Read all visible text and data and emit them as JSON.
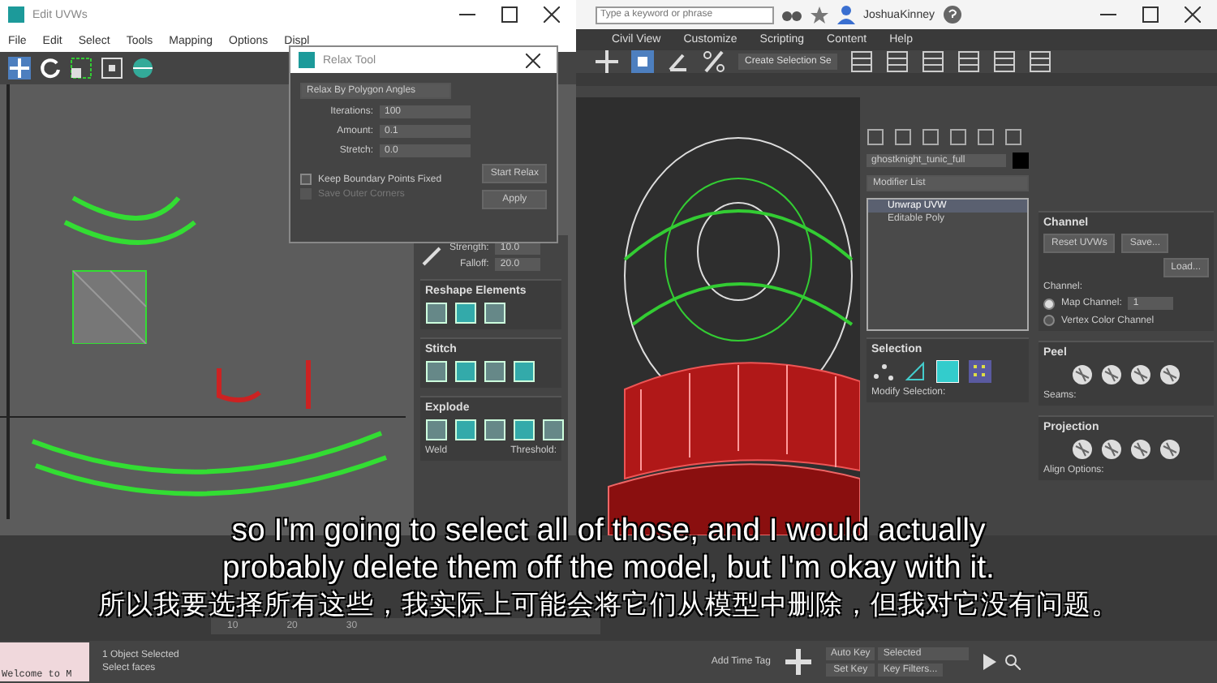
{
  "uvw_window": {
    "title": "Edit UVWs",
    "menu": [
      "File",
      "Edit",
      "Select",
      "Tools",
      "Mapping",
      "Options",
      "Displ"
    ]
  },
  "relax_dialog": {
    "title": "Relax Tool",
    "mode": "Relax By Polygon Angles",
    "fields": [
      {
        "label": "Iterations:",
        "value": "100"
      },
      {
        "label": "Amount:",
        "value": "0.1"
      },
      {
        "label": "Stretch:",
        "value": "0.0"
      }
    ],
    "options": [
      {
        "label": "Keep Boundary Points Fixed",
        "checked": false,
        "disabled": false
      },
      {
        "label": "Save Outer Corners",
        "checked": false,
        "disabled": true
      }
    ],
    "buttons": [
      "Start Relax",
      "Apply"
    ]
  },
  "main_window": {
    "search": {
      "placeholder": "Type a keyword or phrase"
    },
    "user": "JoshuaKinney",
    "menu": [
      "Civil View",
      "Customize",
      "Scripting",
      "Content",
      "Help"
    ],
    "selection_set": "Create Selection Se"
  },
  "tools_panel": {
    "fields": [
      {
        "label": "Strength:",
        "value": "10.0"
      },
      {
        "label": "Falloff:",
        "value": "20.0"
      }
    ],
    "rollouts": [
      "Reshape Elements",
      "Stitch",
      "Explode"
    ],
    "weld_label": "Weld",
    "threshold_label": "Threshold:"
  },
  "command_panel": {
    "object_name": "ghostknight_tunic_full",
    "modifier_list": "Modifier List",
    "stack": [
      {
        "label": "Unwrap UVW",
        "selected": true
      },
      {
        "label": "Editable Poly",
        "selected": false
      }
    ],
    "selection": {
      "title": "Selection",
      "modify_label": "Modify Selection:"
    }
  },
  "uvw_panel": {
    "channel": {
      "title": "Channel",
      "buttons": [
        "Reset UVWs",
        "Save...",
        "Load..."
      ],
      "group": "Channel:",
      "options": [
        {
          "label": "Map Channel:",
          "selected": true
        },
        {
          "label": "Vertex Color Channel",
          "selected": false
        }
      ],
      "map_channel": "1"
    },
    "peel": {
      "title": "Peel",
      "seams": "Seams:"
    },
    "projection": {
      "title": "Projection",
      "align": "Align Options:"
    }
  },
  "timeline": {
    "ticks": [
      "10",
      "20",
      "30"
    ]
  },
  "status_bar": {
    "listener": "Welcome to M",
    "selection": "1 Object Selected",
    "prompt": "Select faces",
    "time_tag": "Add Time Tag",
    "auto_key": "Auto Key",
    "key_mode": "Selected",
    "set_key": "Set Key",
    "key_filters": "Key Filters..."
  },
  "subtitles": {
    "english": [
      "so I'm going to select all of those, and I would actually",
      "probably delete them off the model, but I'm okay with it."
    ],
    "chinese": "所以我要选择所有这些，我实际上可能会将它们从模型中删除，但我对它没有问题。"
  }
}
